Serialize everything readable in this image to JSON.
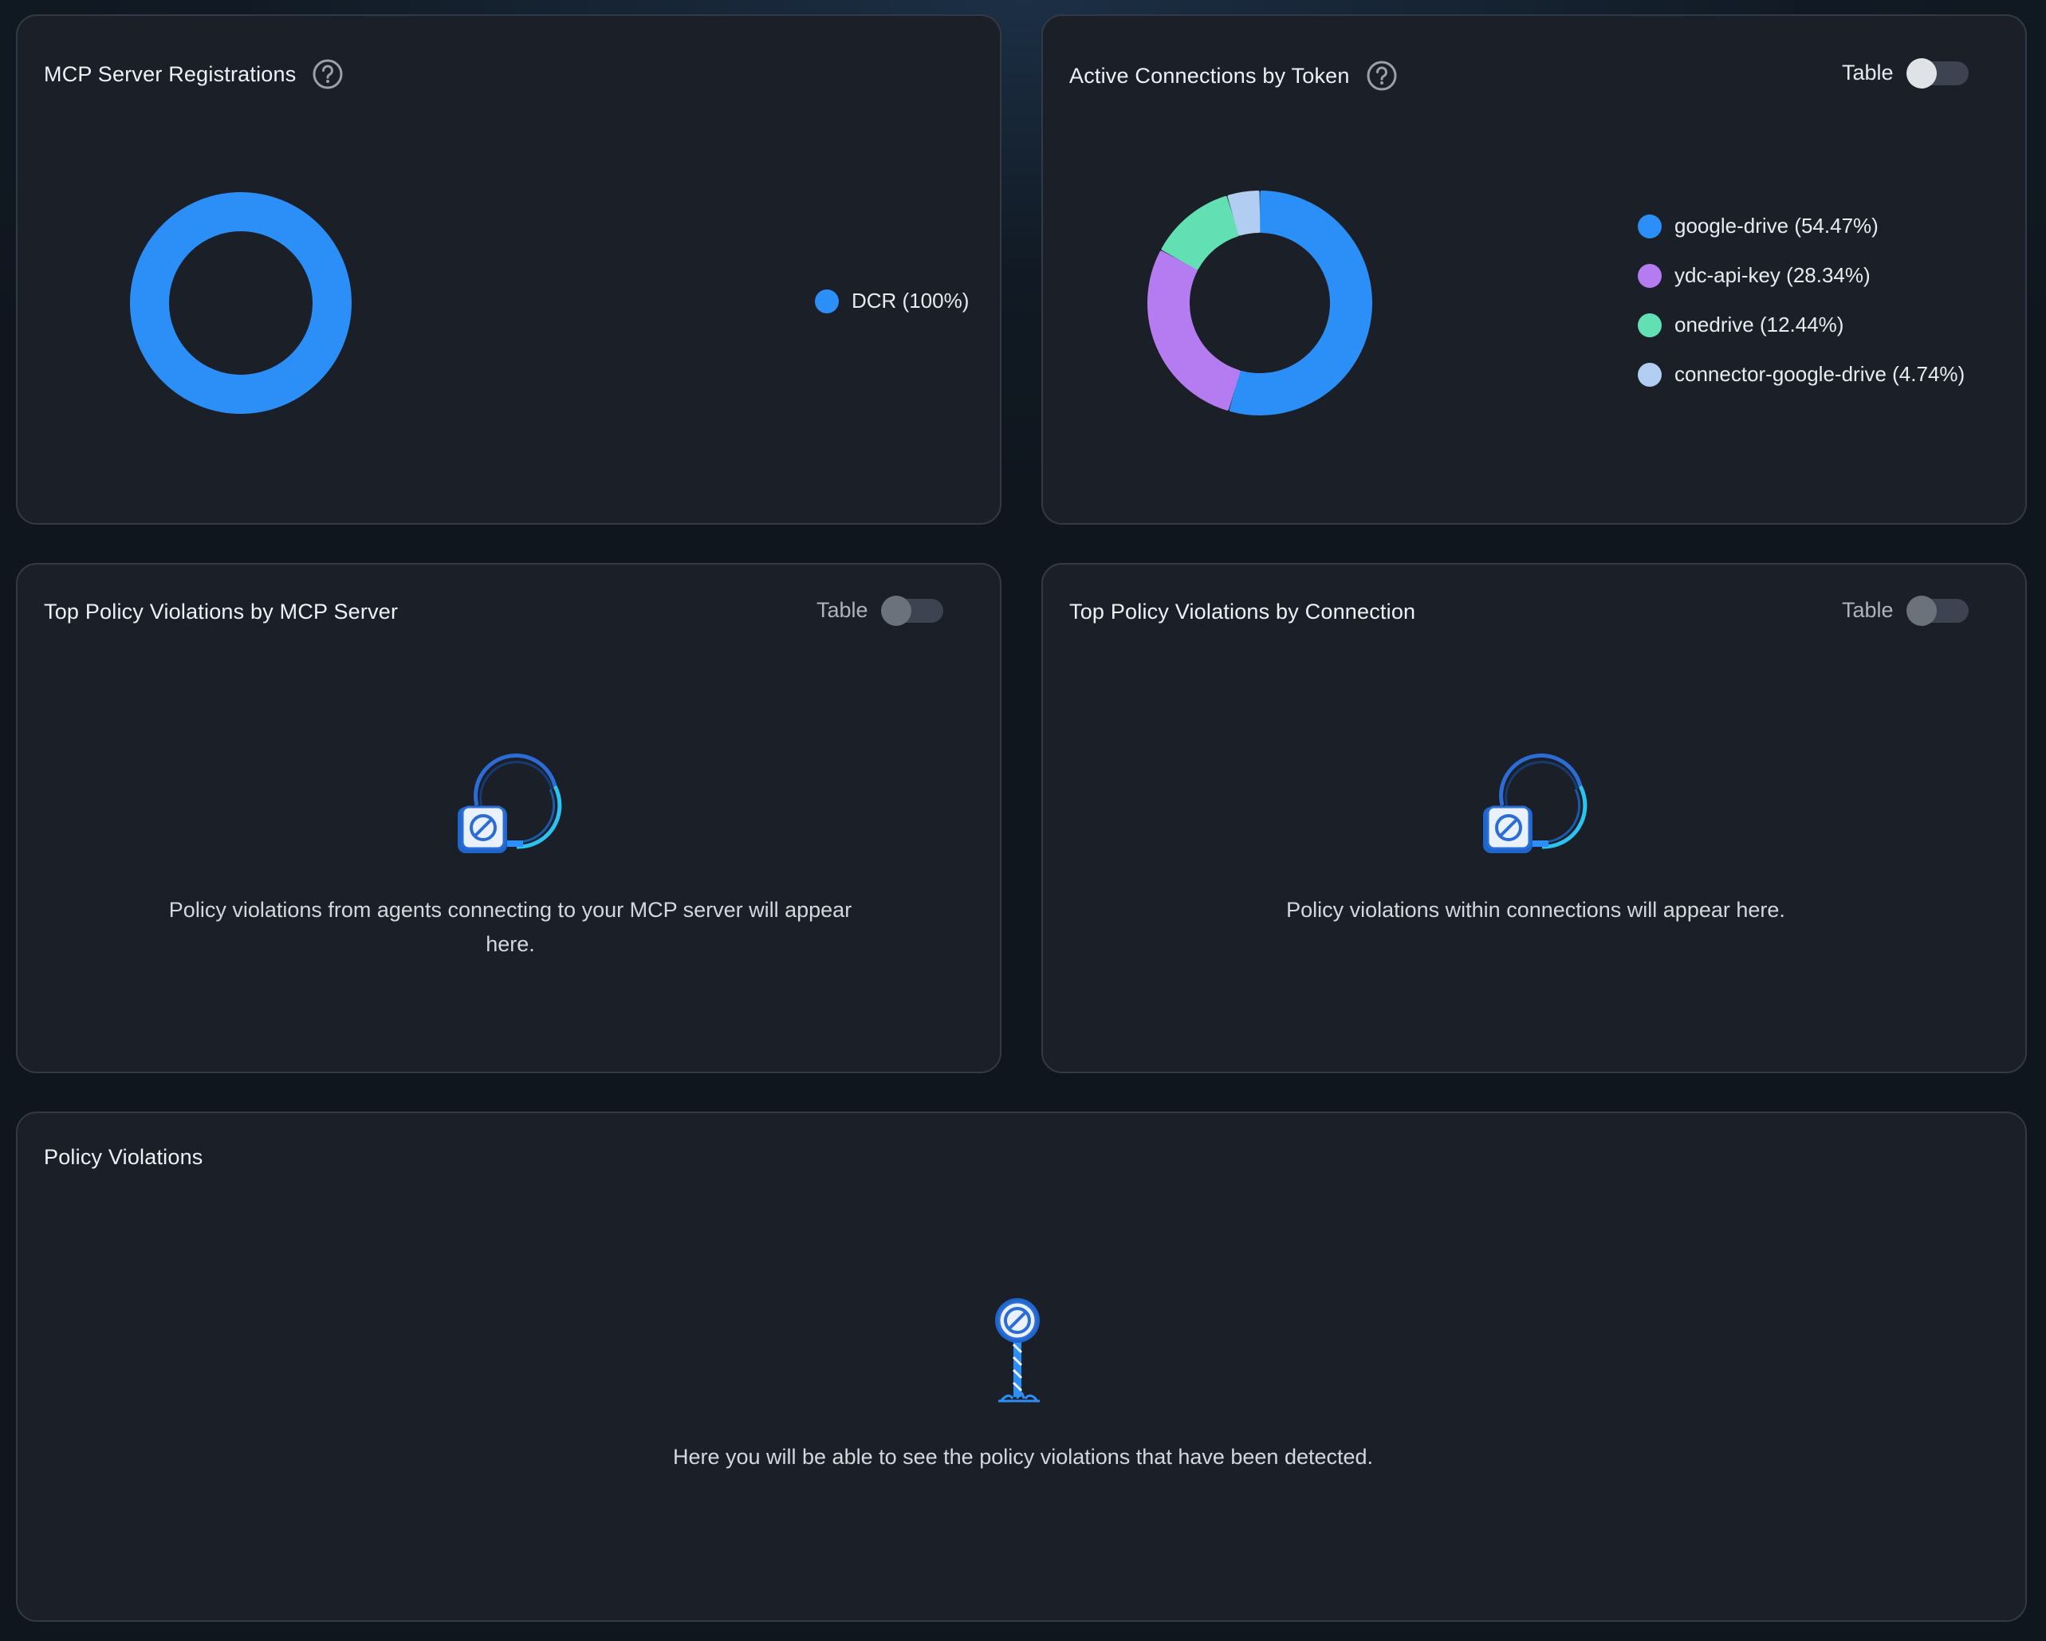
{
  "cards": {
    "registrations": {
      "title": "MCP Server Registrations",
      "chart_data": {
        "type": "pie",
        "categories": [
          "DCR"
        ],
        "values": [
          100
        ],
        "colors": [
          "#2b8ff7"
        ],
        "legend": [
          "DCR (100%)"
        ]
      }
    },
    "connections": {
      "title": "Active Connections by Token",
      "toggle_label": "Table",
      "toggle_on": false,
      "chart_data": {
        "type": "pie",
        "categories": [
          "google-drive",
          "ydc-api-key",
          "onedrive",
          "connector-google-drive"
        ],
        "values": [
          54.47,
          28.34,
          12.44,
          4.74
        ],
        "colors": [
          "#2b8ff7",
          "#b57bf0",
          "#62e0b3",
          "#b1cdf1"
        ],
        "legend": [
          "google-drive (54.47%)",
          "ydc-api-key (28.34%)",
          "onedrive (12.44%)",
          "connector-google-drive (4.74%)"
        ]
      }
    },
    "violations_by_server": {
      "title": "Top Policy Violations by MCP Server",
      "toggle_label": "Table",
      "toggle_on": false,
      "empty_text_line1": "Policy violations from agents connecting to your MCP server will appear",
      "empty_text_line2": "here."
    },
    "violations_by_connection": {
      "title": "Top Policy Violations by Connection",
      "toggle_label": "Table",
      "toggle_on": false,
      "empty_text": "Policy violations within connections will appear here."
    },
    "policy_violations": {
      "title": "Policy Violations",
      "empty_text": "Here you will be able to see the policy violations that have been detected."
    }
  },
  "icons": {
    "help": "question-circle-icon",
    "empty_state_cable": "unplugged-cable-icon",
    "empty_state_sign": "no-entry-sign-icon"
  }
}
